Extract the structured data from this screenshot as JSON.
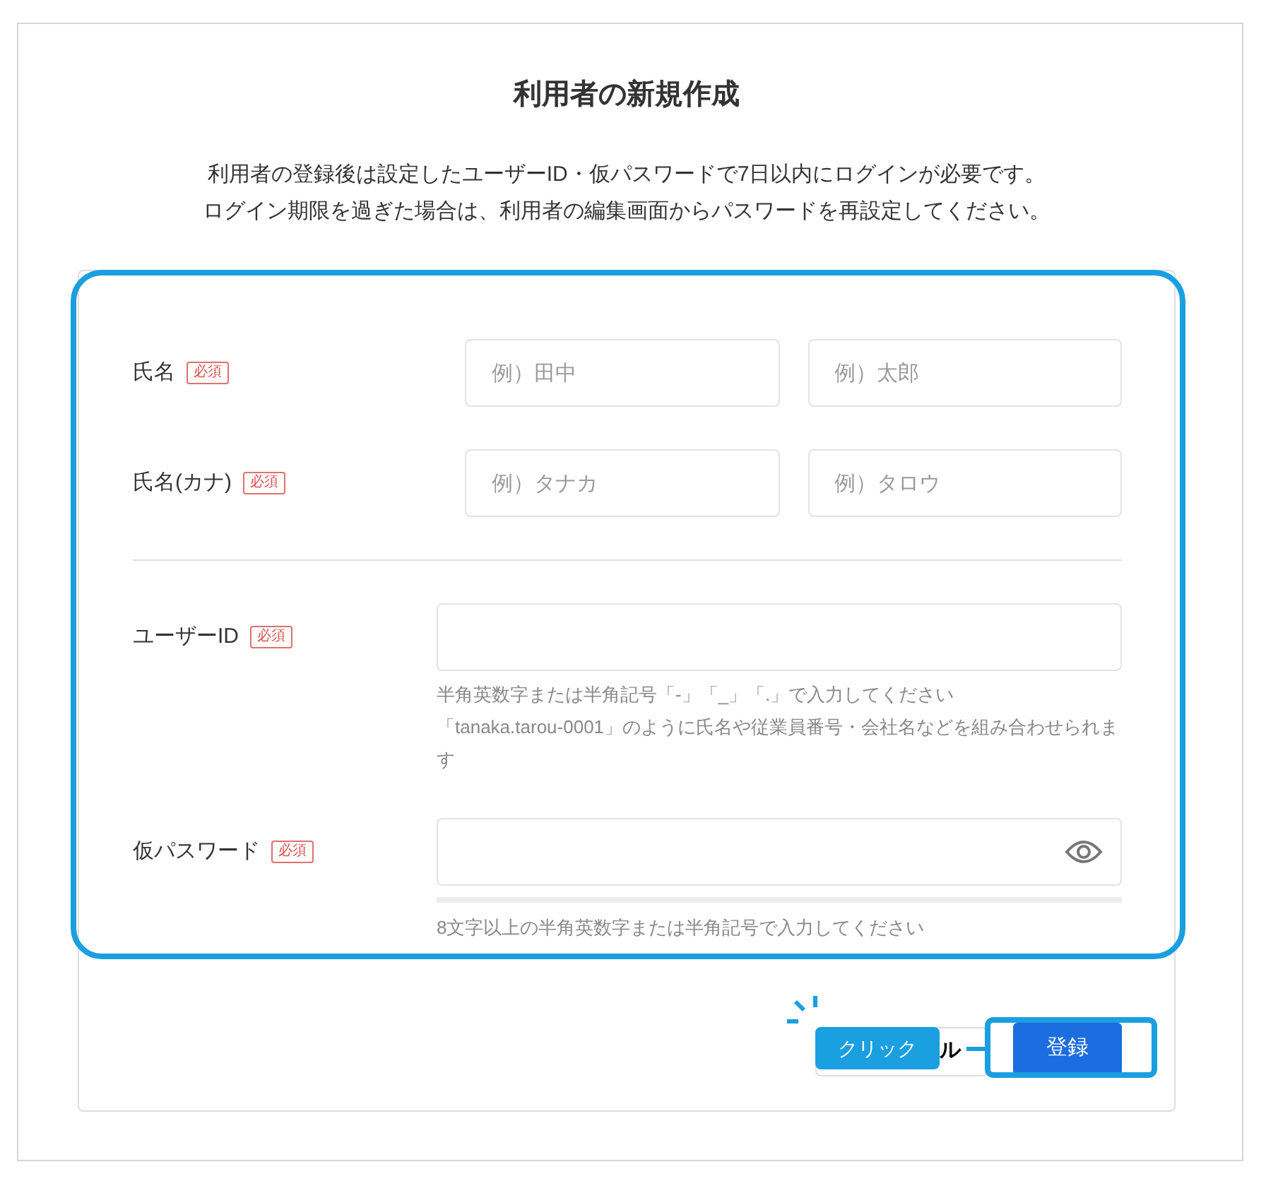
{
  "title": "利用者の新規作成",
  "description": [
    "利用者の登録後は設定したユーザーID・仮パスワードで7日以内にログインが必要です。",
    "ログイン期限を過ぎた場合は、利用者の編集画面からパスワードを再設定してください。"
  ],
  "fields": [
    {
      "kind": "pair",
      "label": "氏名",
      "badge": "必須",
      "inputs": [
        {
          "placeholder": "例）田中"
        },
        {
          "placeholder": "例）太郎"
        }
      ]
    },
    {
      "kind": "pair",
      "label": "氏名(カナ)",
      "badge": "必須",
      "inputs": [
        {
          "placeholder": "例）タナカ"
        },
        {
          "placeholder": "例）タロウ"
        }
      ]
    },
    {
      "kind": "divider"
    },
    {
      "kind": "text",
      "label": "ユーザーID",
      "badge": "必須",
      "hints": [
        "半角英数字または半角記号「-」「_」「.」で入力してください",
        "「tanaka.tarou-0001」のように氏名や従業員番号・会社名などを組み合わせられます"
      ]
    },
    {
      "kind": "password",
      "label": "仮パスワード",
      "badge": "必須",
      "hints": [
        "8文字以上の半角英数字または半角記号で入力してください"
      ]
    }
  ],
  "buttons": [
    {
      "kind": "cancel",
      "label": "ル"
    },
    {
      "kind": "primary",
      "label": "登録"
    }
  ],
  "annotation": {
    "label": "クリック"
  }
}
